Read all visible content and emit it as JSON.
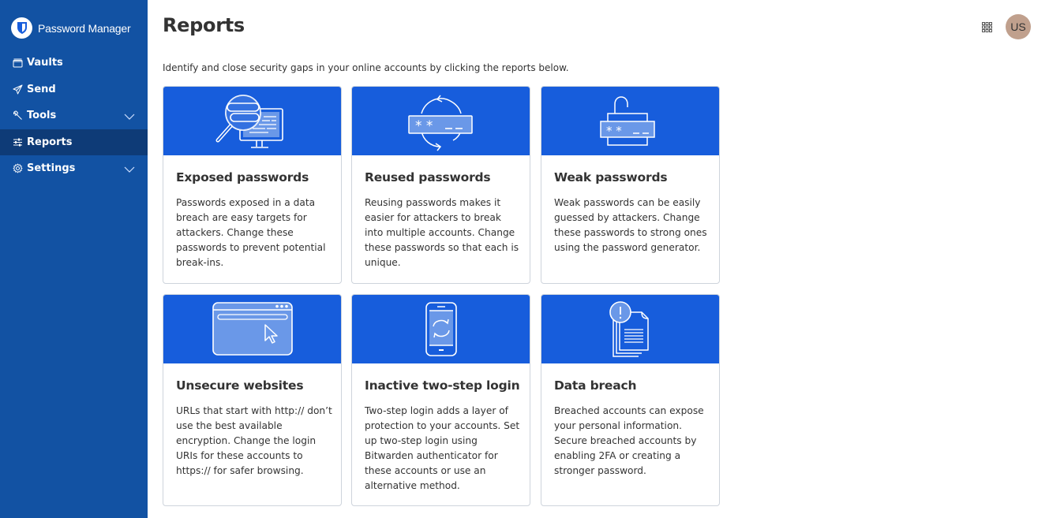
{
  "app": {
    "title": "Password Manager"
  },
  "sidebar": {
    "items": [
      {
        "label": "Vaults",
        "icon": "vault-icon",
        "expandable": false,
        "active": false
      },
      {
        "label": "Send",
        "icon": "send-icon",
        "expandable": false,
        "active": false
      },
      {
        "label": "Tools",
        "icon": "wrench-icon",
        "expandable": true,
        "active": false
      },
      {
        "label": "Reports",
        "icon": "sliders-icon",
        "expandable": false,
        "active": true
      },
      {
        "label": "Settings",
        "icon": "gear-icon",
        "expandable": true,
        "active": false
      }
    ]
  },
  "header": {
    "title": "Reports",
    "avatar_initials": "US"
  },
  "main": {
    "intro": "Identify and close security gaps in your online accounts by clicking the reports below.",
    "cards": [
      {
        "title": "Exposed passwords",
        "description": "Passwords exposed in a data breach are easy targets for attackers. Change these passwords to prevent potential break-ins.",
        "icon": "magnifier-monitor-icon"
      },
      {
        "title": "Reused passwords",
        "description": "Reusing passwords makes it easier for attackers to break into multiple accounts. Change these passwords so that each is unique.",
        "icon": "recycle-password-icon"
      },
      {
        "title": "Weak passwords",
        "description": "Weak passwords can be easily guessed by attackers. Change these passwords to strong ones using the password generator.",
        "icon": "unlocked-padlock-icon"
      },
      {
        "title": "Unsecure websites",
        "description": "URLs that start with http:// don’t use the best available encryption. Change the login URIs for these accounts to https:// for safer browsing.",
        "icon": "browser-cursor-icon"
      },
      {
        "title": "Inactive two-step login",
        "description": "Two-step login adds a layer of protection to your accounts. Set up two-step login using Bitwarden authenticator for these accounts or use an alternative method.",
        "icon": "phone-sync-icon"
      },
      {
        "title": "Data breach",
        "description": "Breached accounts can expose your personal information. Secure breached accounts by enabling 2FA or creating a stronger password.",
        "icon": "documents-alert-icon"
      }
    ]
  },
  "colors": {
    "sidebar": "#1252a3",
    "sidebar_active": "#0e3b77",
    "banner": "#175ddc",
    "illustration_fill": "#6a98e8",
    "avatar": "#c0a08d"
  }
}
